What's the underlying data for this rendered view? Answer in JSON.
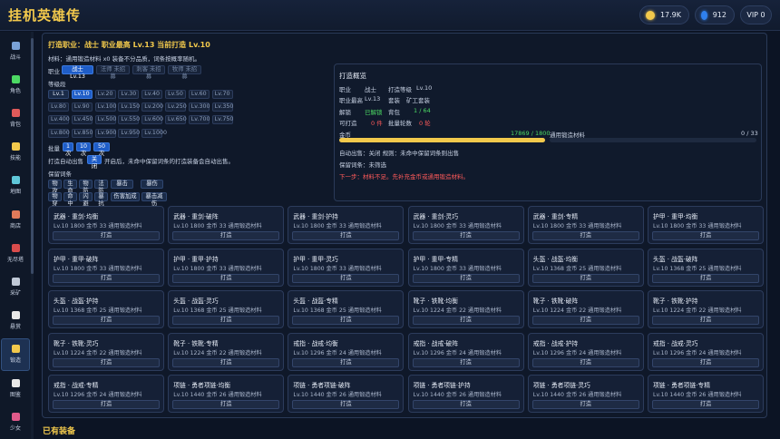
{
  "header": {
    "title": "挂机英雄传",
    "gold": "17.9K",
    "gems": "912",
    "vip": "VIP 0"
  },
  "sidebar": {
    "items": [
      {
        "label": "战斗",
        "icon": "battle-icon",
        "color": "#7aa2d6"
      },
      {
        "label": "角色",
        "icon": "character-icon",
        "color": "#4cd964"
      },
      {
        "label": "背包",
        "icon": "bag-icon",
        "color": "#e05a5a"
      },
      {
        "label": "技能",
        "icon": "skill-icon",
        "color": "#f2c94c"
      },
      {
        "label": "地图",
        "icon": "map-icon",
        "color": "#5fc7d9"
      },
      {
        "label": "商店",
        "icon": "shop-icon",
        "color": "#e07a5a"
      },
      {
        "label": "无尽塔",
        "icon": "tower-icon",
        "color": "#d94c4c"
      },
      {
        "label": "采矿",
        "icon": "mining-icon",
        "color": "#bfc8d6"
      },
      {
        "label": "悬赏",
        "icon": "bounty-icon",
        "color": "#e8e8e8"
      },
      {
        "label": "锻造",
        "icon": "forge-icon",
        "color": "#f2c94c"
      },
      {
        "label": "图鉴",
        "icon": "codex-icon",
        "color": "#e8e8e8"
      },
      {
        "label": "少女",
        "icon": "girl-icon",
        "color": "#e05a8a"
      }
    ]
  },
  "forge": {
    "title": "打造职业：战士  职业最高 Lv.13  当前打造 Lv.10",
    "material_line": "材料：通用锻造材料 x0    装备不分品质，词条按概率随机。",
    "class_label": "职业",
    "classes": [
      "战士 Lv.13",
      "法师 未招募",
      "刺客 未招募",
      "牧师 未招募"
    ],
    "level_label": "等级段",
    "levels": [
      "Lv.1",
      "Lv.10",
      "Lv.20",
      "Lv.30",
      "Lv.40",
      "Lv.50",
      "Lv.60",
      "Lv.70",
      "Lv.80",
      "Lv.90",
      "Lv.100",
      "Lv.150",
      "Lv.200",
      "Lv.250",
      "Lv.300",
      "Lv.350",
      "Lv.400",
      "Lv.450",
      "Lv.500",
      "Lv.550",
      "Lv.600",
      "Lv.650",
      "Lv.700",
      "Lv.750",
      "Lv.800",
      "Lv.850",
      "Lv.900",
      "Lv.950",
      "Lv.1000"
    ],
    "batch_label": "批量",
    "batch": [
      "1次",
      "10次",
      "50次"
    ],
    "auto_sell_label": "打造自动出售",
    "auto_sell_state": "关闭",
    "auto_sell_note": "开启后，未命中保留词条的打造装备会自动出售。",
    "keep_label": "保留词条",
    "keep_tags": [
      "物攻",
      "生命",
      "物防",
      "法防",
      "暴击",
      "暴伤",
      "物穿",
      "命中",
      "闪避",
      "暴抗",
      "伤害加成",
      "暴击减伤"
    ]
  },
  "overview": {
    "title": "打造概览",
    "class_k": "职业",
    "class_v": "战士",
    "forge_lv_k": "打造等级",
    "forge_lv_v": "Lv.10",
    "max_k": "职业最高",
    "max_v": "Lv.13",
    "set_k": "套装",
    "set_v": "矿工套装",
    "unlock_k": "解锁",
    "unlock_v": "已解锁",
    "bag_k": "背包",
    "bag_v": "1 / 64",
    "can_k": "可打造",
    "can_v": "0 件",
    "rounds_k": "批量轮数",
    "rounds_v": "0 轮",
    "gold_k": "金币",
    "gold_v": "17869 / 1800",
    "gold_ratio": 1.0,
    "mat_k": "通用锻造材料",
    "mat_v": "0 / 33",
    "mat_ratio": 0.0,
    "auto_line": "自动出售：关闭    规则：未命中保留词条则出售",
    "keep_line": "保留词条：未筛选",
    "next_line": "下一步：材料不足。先补充金币或通用锻造材料。"
  },
  "cards": [
    {
      "name": "武器 · 重剑·均衡",
      "info": "Lv.10  1800 金币  33 通用锻造材料",
      "btn": "打造"
    },
    {
      "name": "武器 · 重剑·破阵",
      "info": "Lv.10  1800 金币  33 通用锻造材料",
      "btn": "打造"
    },
    {
      "name": "武器 · 重剑·护持",
      "info": "Lv.10  1800 金币  33 通用锻造材料",
      "btn": "打造"
    },
    {
      "name": "武器 · 重剑·灵巧",
      "info": "Lv.10  1800 金币  33 通用锻造材料",
      "btn": "打造"
    },
    {
      "name": "武器 · 重剑·专精",
      "info": "Lv.10  1800 金币  33 通用锻造材料",
      "btn": "打造"
    },
    {
      "name": "护甲 · 重甲·均衡",
      "info": "Lv.10  1800 金币  33 通用锻造材料",
      "btn": "打造"
    },
    {
      "name": "护甲 · 重甲·破阵",
      "info": "Lv.10  1800 金币  33 通用锻造材料",
      "btn": "打造"
    },
    {
      "name": "护甲 · 重甲·护持",
      "info": "Lv.10  1800 金币  33 通用锻造材料",
      "btn": "打造"
    },
    {
      "name": "护甲 · 重甲·灵巧",
      "info": "Lv.10  1800 金币  33 通用锻造材料",
      "btn": "打造"
    },
    {
      "name": "护甲 · 重甲·专精",
      "info": "Lv.10  1800 金币  33 通用锻造材料",
      "btn": "打造"
    },
    {
      "name": "头盔 · 战盔·均衡",
      "info": "Lv.10  1368 金币  25 通用锻造材料",
      "btn": "打造"
    },
    {
      "name": "头盔 · 战盔·破阵",
      "info": "Lv.10  1368 金币  25 通用锻造材料",
      "btn": "打造"
    },
    {
      "name": "头盔 · 战盔·护持",
      "info": "Lv.10  1368 金币  25 通用锻造材料",
      "btn": "打造"
    },
    {
      "name": "头盔 · 战盔·灵巧",
      "info": "Lv.10  1368 金币  25 通用锻造材料",
      "btn": "打造"
    },
    {
      "name": "头盔 · 战盔·专精",
      "info": "Lv.10  1368 金币  25 通用锻造材料",
      "btn": "打造"
    },
    {
      "name": "靴子 · 铁靴·均衡",
      "info": "Lv.10  1224 金币  22 通用锻造材料",
      "btn": "打造"
    },
    {
      "name": "靴子 · 铁靴·破阵",
      "info": "Lv.10  1224 金币  22 通用锻造材料",
      "btn": "打造"
    },
    {
      "name": "靴子 · 铁靴·护持",
      "info": "Lv.10  1224 金币  22 通用锻造材料",
      "btn": "打造"
    },
    {
      "name": "靴子 · 铁靴·灵巧",
      "info": "Lv.10  1224 金币  22 通用锻造材料",
      "btn": "打造"
    },
    {
      "name": "靴子 · 铁靴·专精",
      "info": "Lv.10  1224 金币  22 通用锻造材料",
      "btn": "打造"
    },
    {
      "name": "戒指 · 战戒·均衡",
      "info": "Lv.10  1296 金币  24 通用锻造材料",
      "btn": "打造"
    },
    {
      "name": "戒指 · 战戒·破阵",
      "info": "Lv.10  1296 金币  24 通用锻造材料",
      "btn": "打造"
    },
    {
      "name": "戒指 · 战戒·护持",
      "info": "Lv.10  1296 金币  24 通用锻造材料",
      "btn": "打造"
    },
    {
      "name": "戒指 · 战戒·灵巧",
      "info": "Lv.10  1296 金币  24 通用锻造材料",
      "btn": "打造"
    },
    {
      "name": "戒指 · 战戒·专精",
      "info": "Lv.10  1296 金币  24 通用锻造材料",
      "btn": "打造"
    },
    {
      "name": "项链 · 勇者项链·均衡",
      "info": "Lv.10  1440 金币  26 通用锻造材料",
      "btn": "打造"
    },
    {
      "name": "项链 · 勇者项链·破阵",
      "info": "Lv.10  1440 金币  26 通用锻造材料",
      "btn": "打造"
    },
    {
      "name": "项链 · 勇者项链·护持",
      "info": "Lv.10  1440 金币  26 通用锻造材料",
      "btn": "打造"
    },
    {
      "name": "项链 · 勇者项链·灵巧",
      "info": "Lv.10  1440 金币  26 通用锻造材料",
      "btn": "打造"
    },
    {
      "name": "项链 · 勇者项链·专精",
      "info": "Lv.10  1440 金币  26 通用锻造材料",
      "btn": "打造"
    }
  ],
  "owned_title": "已有装备"
}
